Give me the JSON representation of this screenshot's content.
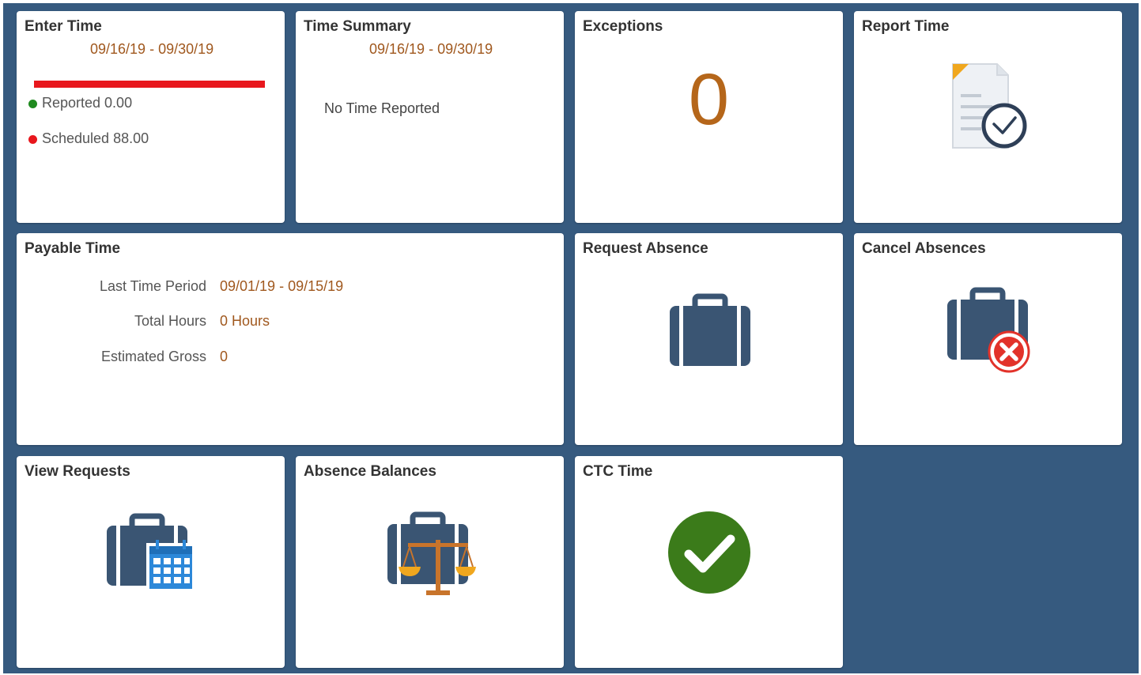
{
  "tiles": {
    "enter_time": {
      "title": "Enter Time",
      "period": "09/16/19 - 09/30/19",
      "reported": "Reported 0.00",
      "scheduled": "Scheduled 88.00",
      "reported_fraction": 0.0,
      "bar_color": "#e8171d",
      "reported_dot_color": "#1f8a1f",
      "scheduled_dot_color": "#e8171d"
    },
    "time_summary": {
      "title": "Time Summary",
      "period": "09/16/19 - 09/30/19",
      "status": "No Time Reported"
    },
    "exceptions": {
      "title": "Exceptions",
      "count": "0"
    },
    "report_time": {
      "title": "Report Time",
      "icon": "report-time-icon"
    },
    "payable_time": {
      "title": "Payable Time",
      "rows": [
        {
          "label": "Last Time Period",
          "value": "09/01/19 - 09/15/19"
        },
        {
          "label": "Total Hours",
          "value": "0 Hours"
        },
        {
          "label": "Estimated Gross",
          "value": "0"
        }
      ]
    },
    "request_absence": {
      "title": "Request Absence",
      "icon": "briefcase-icon"
    },
    "cancel_absences": {
      "title": "Cancel Absences",
      "icon": "briefcase-cancel-icon"
    },
    "view_requests": {
      "title": "View Requests",
      "icon": "briefcase-calendar-icon"
    },
    "absence_balances": {
      "title": "Absence Balances",
      "icon": "briefcase-scale-icon"
    },
    "ctc_time": {
      "title": "CTC Time",
      "icon": "check-circle-icon"
    }
  },
  "colors": {
    "background": "#365a7f",
    "accent_value": "#a0581e",
    "icon_dark": "#3a5573",
    "check_green": "#3b7b1a"
  }
}
